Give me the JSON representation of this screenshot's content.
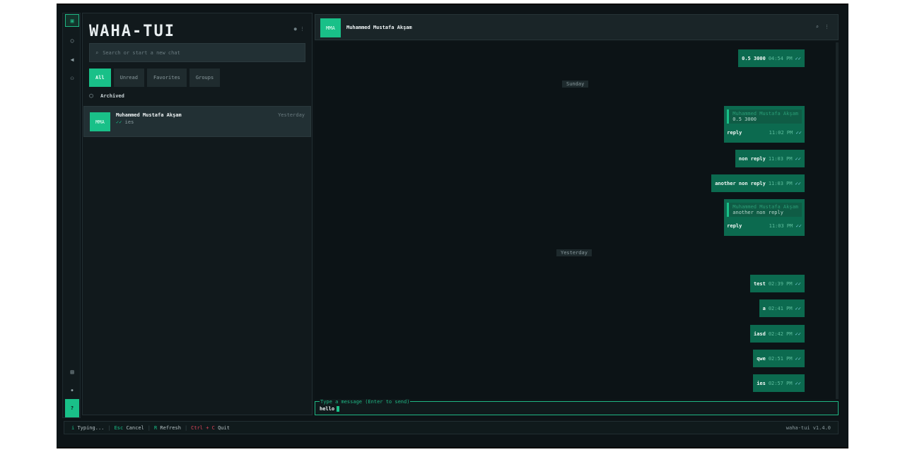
{
  "app": {
    "logo": "WAHA-TUI",
    "version": "waha-tui v1.4.0"
  },
  "rail": {
    "icons": [
      "chat-icon",
      "status-icon",
      "channels-icon",
      "communities-icon",
      "archive-icon",
      "settings-icon"
    ],
    "help_label": "?"
  },
  "left": {
    "search_placeholder": "Search or start a new chat",
    "filters": [
      "All",
      "Unread",
      "Favorites",
      "Groups"
    ],
    "archived_label": "Archived",
    "chats": [
      {
        "initials": "MMA",
        "name": "Muhammed Mustafa Akşam",
        "checks": "✓✓",
        "preview": "ies",
        "time": "Yesterday"
      }
    ]
  },
  "chat": {
    "initials": "MMA",
    "name": "Muhammed Mustafa Akşam",
    "messages": [
      {
        "text": "0.5 3000",
        "time": "04:54 PM",
        "checks": "✓✓"
      },
      {
        "separator": "Sunday"
      },
      {
        "text": "reply",
        "time": "11:02 PM",
        "checks": "✓✓",
        "quote_name": "Muhammed Mustafa Akşam",
        "quote_text": "0.5 3000"
      },
      {
        "text": "non reply",
        "time": "11:03 PM",
        "checks": "✓✓"
      },
      {
        "text": "another non reply",
        "time": "11:03 PM",
        "checks": "✓✓"
      },
      {
        "text": "reply",
        "time": "11:03 PM",
        "checks": "✓✓",
        "quote_name": "Muhammed Mustafa Akşam",
        "quote_text": "another non reply"
      },
      {
        "separator": "Yesterday"
      },
      {
        "text": "test",
        "time": "02:39 PM",
        "checks": "✓✓"
      },
      {
        "text": "a",
        "time": "02:41 PM",
        "checks": "✓✓"
      },
      {
        "text": "iasd",
        "time": "02:42 PM",
        "checks": "✓✓"
      },
      {
        "text": "qwe",
        "time": "02:51 PM",
        "checks": "✓✓"
      },
      {
        "text": "ies",
        "time": "02:57 PM",
        "checks": "✓✓"
      }
    ],
    "input": {
      "label": "Type a message (Enter to send)",
      "value": "hello"
    }
  },
  "status": {
    "mode_key": "i",
    "mode": "Typing...",
    "k1": "Esc",
    "a1": "Cancel",
    "k2": "R",
    "a2": "Refresh",
    "k3": "Ctrl + C",
    "a3": "Quit"
  }
}
